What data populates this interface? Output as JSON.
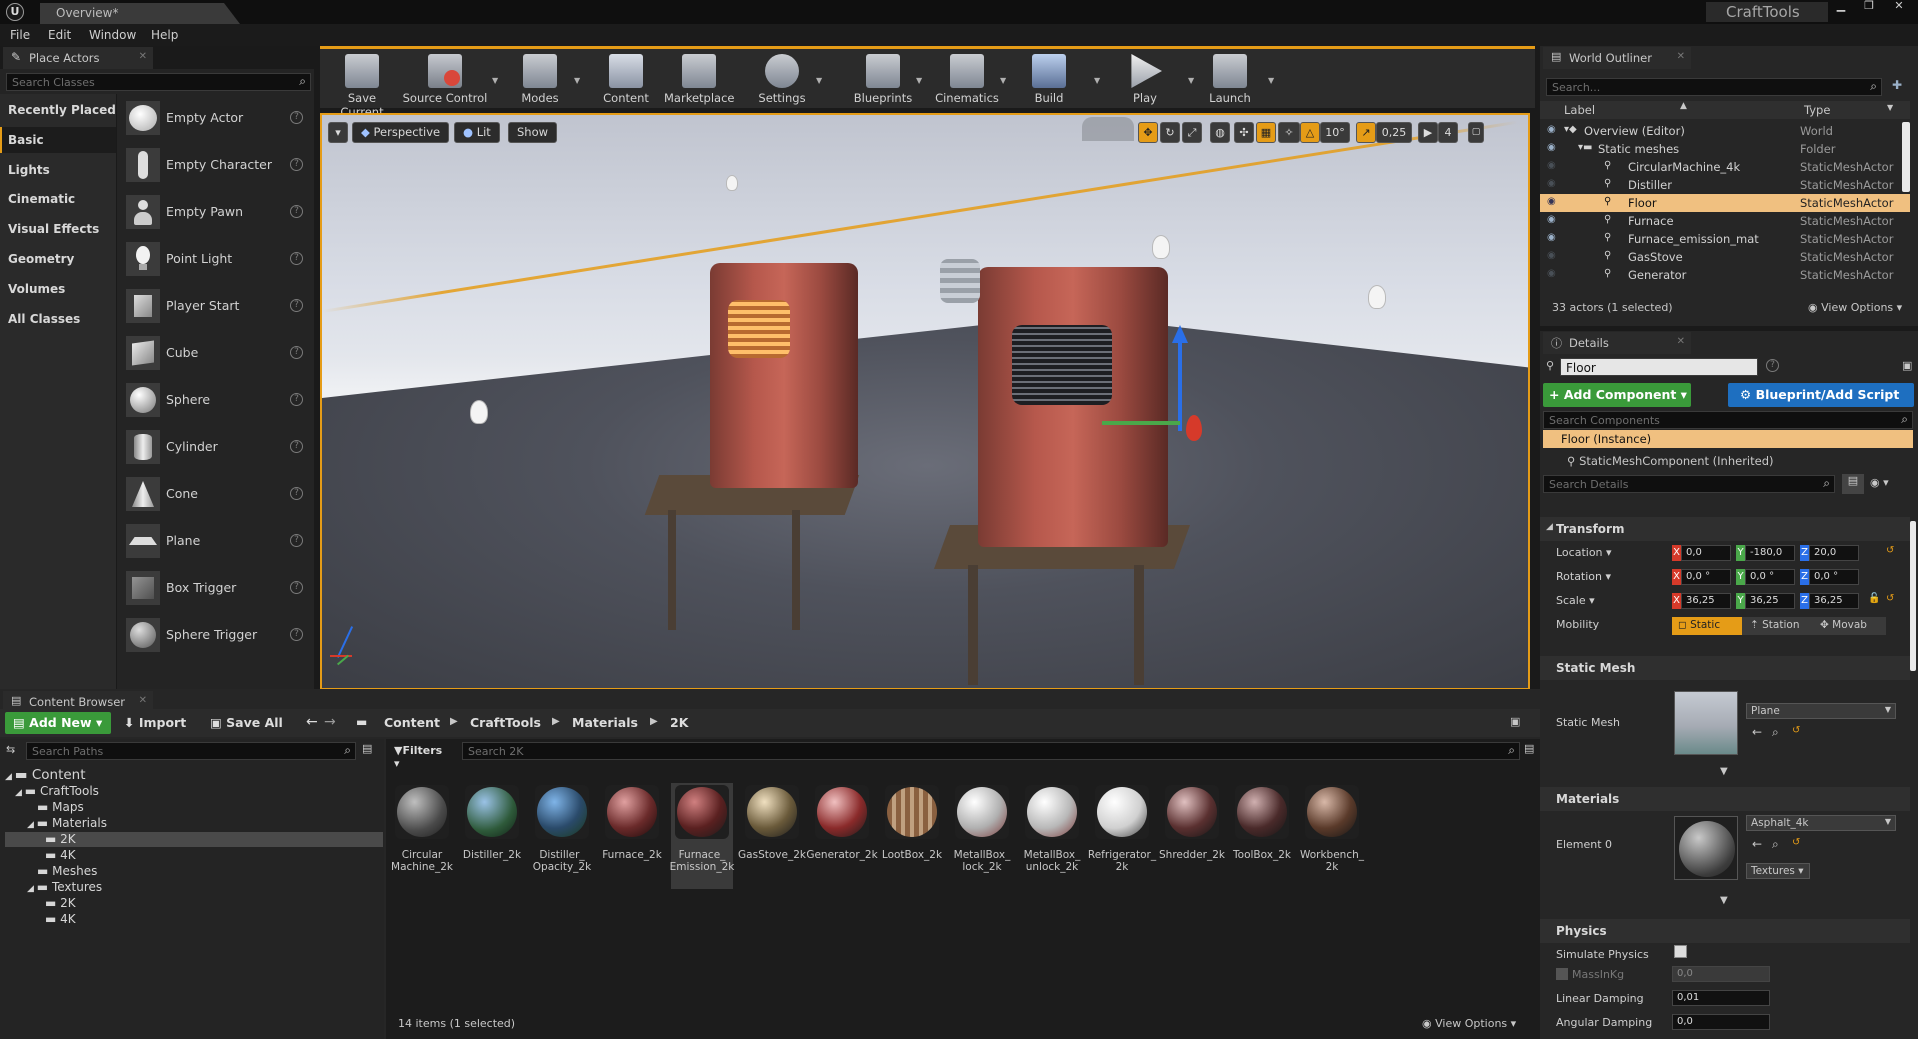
{
  "titlebar": {
    "doc_tab": "Overview*",
    "app_name": "CraftTools",
    "min": "▁",
    "max": "❐",
    "close": "✕"
  },
  "menu": [
    "File",
    "Edit",
    "Window",
    "Help"
  ],
  "place_actors": {
    "tab": "Place Actors",
    "search_placeholder": "Search Classes",
    "categories": [
      "Recently Placed",
      "Basic",
      "Lights",
      "Cinematic",
      "Visual Effects",
      "Geometry",
      "Volumes",
      "All Classes"
    ],
    "actors": [
      "Empty Actor",
      "Empty Character",
      "Empty Pawn",
      "Point Light",
      "Player Start",
      "Cube",
      "Sphere",
      "Cylinder",
      "Cone",
      "Plane",
      "Box Trigger",
      "Sphere Trigger"
    ]
  },
  "toolbar": {
    "buttons": [
      "Save Current",
      "Source Control",
      "Modes",
      "Content",
      "Marketplace",
      "Settings",
      "Blueprints",
      "Cinematics",
      "Build",
      "Play",
      "Launch"
    ]
  },
  "viewport": {
    "perspective": "Perspective",
    "lit": "Lit",
    "show": "Show",
    "rot_snap": "10°",
    "scale_snap": "0,25",
    "cam_speed": "4"
  },
  "outliner": {
    "tab": "World Outliner",
    "search_placeholder": "Search...",
    "col_label": "Label",
    "col_type": "Type",
    "rows": [
      {
        "label": "Overview (Editor)",
        "type": "World"
      },
      {
        "label": "Static meshes",
        "type": "Folder"
      },
      {
        "label": "CircularMachine_4k",
        "type": "StaticMeshActor"
      },
      {
        "label": "Distiller",
        "type": "StaticMeshActor"
      },
      {
        "label": "Floor",
        "type": "StaticMeshActor"
      },
      {
        "label": "Furnace",
        "type": "StaticMeshActor"
      },
      {
        "label": "Furnace_emission_mat",
        "type": "StaticMeshActor"
      },
      {
        "label": "GasStove",
        "type": "StaticMeshActor"
      },
      {
        "label": "Generator",
        "type": "StaticMeshActor"
      }
    ],
    "status": "33 actors (1 selected)",
    "view_options": "View Options"
  },
  "details": {
    "tab": "Details",
    "name": "Floor",
    "add_component": "+ Add Component",
    "blueprint_script": "Blueprint/Add Script",
    "search_components": "Search Components",
    "instance": "Floor (Instance)",
    "component": "StaticMeshComponent (Inherited)",
    "search_details": "Search Details",
    "transform": {
      "title": "Transform",
      "location_label": "Location",
      "rotation_label": "Rotation",
      "scale_label": "Scale",
      "mobility_label": "Mobility",
      "location": [
        "0,0",
        "-180,0",
        "20,0"
      ],
      "rotation": [
        "0,0 °",
        "0,0 °",
        "0,0 °"
      ],
      "scale": [
        "36,25",
        "36,25",
        "36,25"
      ],
      "mobility": [
        "Static",
        "Station",
        "Movab"
      ]
    },
    "static_mesh": {
      "title": "Static Mesh",
      "label": "Static Mesh",
      "value": "Plane"
    },
    "materials": {
      "title": "Materials",
      "label": "Element 0",
      "value": "Asphalt_4k",
      "textures": "Textures"
    },
    "physics": {
      "title": "Physics",
      "simulate": "Simulate Physics",
      "mass": "MassInKg",
      "mass_value": "0,0",
      "linear": "Linear Damping",
      "linear_value": "0,01",
      "angular": "Angular Damping",
      "angular_value": "0,0"
    }
  },
  "content_browser": {
    "tab": "Content Browser",
    "add_new": "Add New",
    "import": "Import",
    "save_all": "Save All",
    "breadcrumb": [
      "Content",
      "CraftTools",
      "Materials",
      "2K"
    ],
    "search_paths": "Search Paths",
    "filters": "Filters",
    "search_assets": "Search 2K",
    "tree": [
      "Content",
      "CraftTools",
      "Maps",
      "Materials",
      "2K",
      "4K",
      "Meshes",
      "Textures",
      "2K",
      "4K"
    ],
    "assets": [
      "Circular\nMachine_2k",
      "Distiller_2k",
      "Distiller_\nOpacity_2k",
      "Furnace_2k",
      "Furnace_\nEmission_2k",
      "GasStove_2k",
      "Generator_2k",
      "LootBox_2k",
      "MetallBox_\nlock_2k",
      "MetallBox_\nunlock_2k",
      "Refrigerator_\n2k",
      "Shredder_2k",
      "ToolBox_2k",
      "Workbench_\n2k"
    ],
    "status": "14 items (1 selected)",
    "view_options": "View Options"
  },
  "colors": {
    "accent": "#e59c17",
    "green": "#3a9a3a",
    "blue": "#1e6fc0",
    "selection": "#f0c080"
  }
}
